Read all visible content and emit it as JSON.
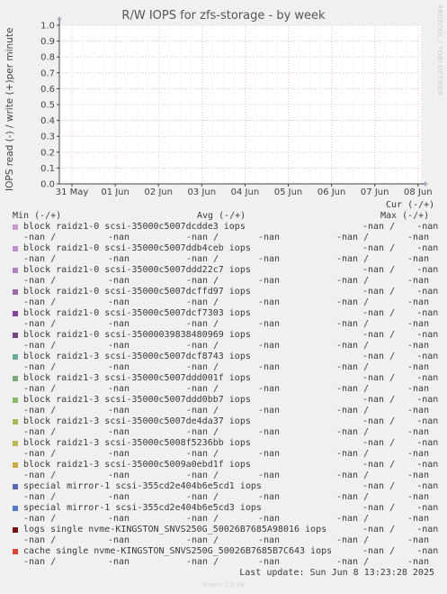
{
  "title": "R/W IOPS for zfs-storage - by week",
  "ylabel": "IOPS read (-) / write (+)per minute",
  "side_brand": "RRDTOOL / TOBI OETIKER",
  "colors": {
    "grid": "#e8a0a0",
    "gridv": "#d6d6ff",
    "axis": "#444444",
    "plotbg": "#ffffff"
  },
  "chart_data": {
    "type": "line",
    "title": "R/W IOPS for zfs-storage - by week",
    "ylabel": "IOPS read (-) / write (+)per minute",
    "xlabel": "",
    "ylim": [
      0.0,
      1.0
    ],
    "yticks": [
      "0.0",
      "0.1",
      "0.2",
      "0.3",
      "0.4",
      "0.5",
      "0.6",
      "0.7",
      "0.8",
      "0.9",
      "1.0"
    ],
    "xticks": [
      "31 May",
      "01 Jun",
      "02 Jun",
      "03 Jun",
      "04 Jun",
      "05 Jun",
      "06 Jun",
      "07 Jun",
      "08 Jun"
    ],
    "grid": true,
    "series": []
  },
  "legend": {
    "header_cur": "Cur (-/+)",
    "header_min": "Min (-/+)",
    "header_avg": "Avg (-/+)",
    "header_max": "Max (-/+)",
    "items": [
      {
        "label": "block raidz1-0 scsi-35000c5007dcdde3 iops",
        "color": "#cc99cc"
      },
      {
        "label": "block raidz1-0 scsi-35000c5007ddb4ceb iops",
        "color": "#bf8fcf"
      },
      {
        "label": "block raidz1-0 scsi-35000c5007ddd22c7 iops",
        "color": "#b07fbf"
      },
      {
        "label": "block raidz1-0 scsi-35000c5007dcffd97 iops",
        "color": "#9966aa"
      },
      {
        "label": "block raidz1-0 scsi-35000c5007dcf7303 iops",
        "color": "#884499"
      },
      {
        "label": "block raidz1-0 scsi-35000039838480969 iops",
        "color": "#774488"
      },
      {
        "label": "block raidz1-3 scsi-35000c5007dcf8743 iops",
        "color": "#66aa99"
      },
      {
        "label": "block raidz1-3 scsi-35000c5007ddd001f iops",
        "color": "#77aa77"
      },
      {
        "label": "block raidz1-3 scsi-35000c5007ddd0bb7 iops",
        "color": "#88bb66"
      },
      {
        "label": "block raidz1-3 scsi-35000c5007de4da37 iops",
        "color": "#aabb55"
      },
      {
        "label": "block raidz1-3 scsi-35000c5008f5236bb iops",
        "color": "#bbbb55"
      },
      {
        "label": "block raidz1-3 scsi-35000c5009a0ebd1f iops",
        "color": "#ccaa44"
      },
      {
        "label": "special mirror-1 scsi-355cd2e404b6e5cd1 iops",
        "color": "#5566bb"
      },
      {
        "label": "special mirror-1 scsi-355cd2e404b6e5cd3 iops",
        "color": "#5577cc"
      },
      {
        "label": "logs single nvme-KINGSTON_SNVS250G_50026B7685A98016 iops",
        "color": "#771111"
      },
      {
        "label": "cache single nvme-KINGSTON_SNVS250G_50026B7685B7C643 iops",
        "color": "#dd4433"
      }
    ],
    "values": {
      "cur": "-nan /    -nan",
      "min": "-nan /",
      "min2": "-nan",
      "avg": "-nan /",
      "avg2": "-nan",
      "max": "-nan /",
      "max2": "-nan"
    }
  },
  "footer": "Last update: Sun Jun  8 13:23:28 2025",
  "munin_version": "Munin 2.0.76"
}
